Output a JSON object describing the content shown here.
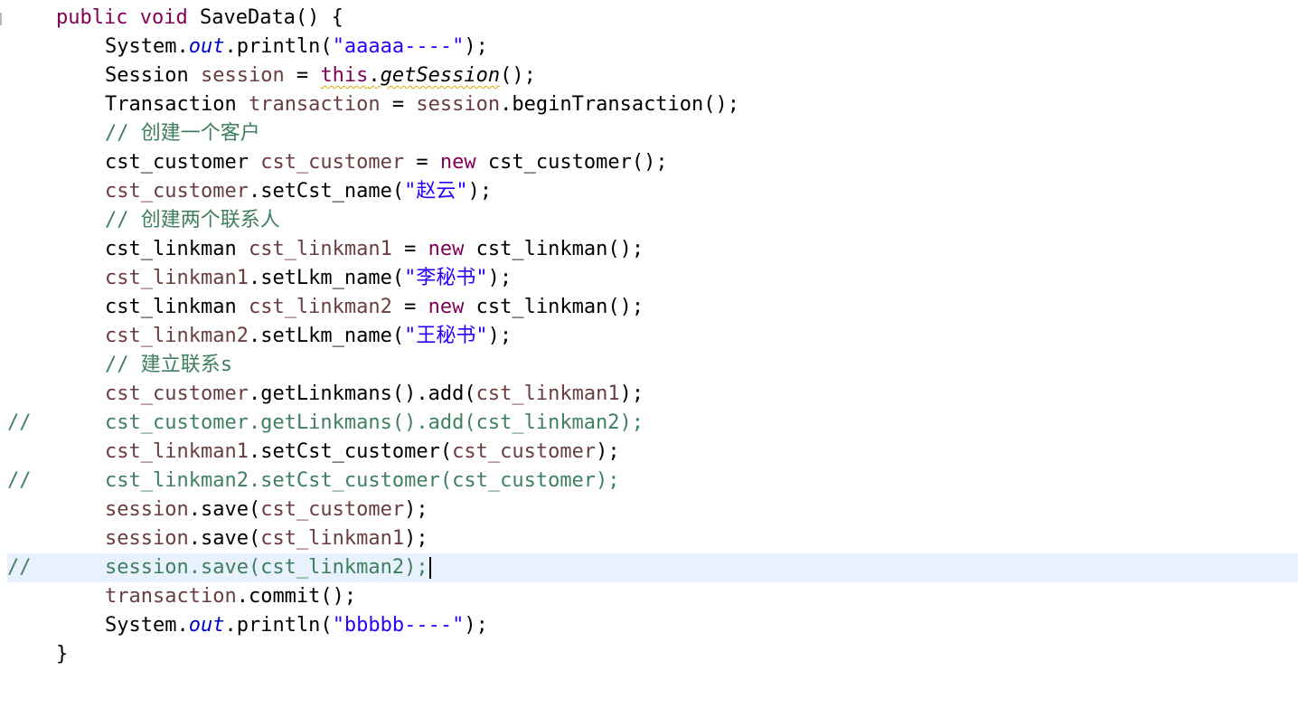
{
  "editor": {
    "line_comment_marker": "//",
    "line1": {
      "kw1": "public",
      "kw2": "void",
      "name": "SaveData() {"
    },
    "line2": {
      "a": "System.",
      "field": "out",
      "b": ".println(",
      "str": "\"aaaaa----\"",
      "c": ");"
    },
    "line3": {
      "type": "Session",
      "var": "session",
      "eq": " = ",
      "kw": "this",
      "dot": ".",
      "call": "getSession",
      "end": "();"
    },
    "line4": {
      "type": "Transaction",
      "var": "transaction",
      "eq": " = ",
      "obj": "session",
      "call": ".beginTransaction();"
    },
    "line5": {
      "comment": "// 创建一个客户"
    },
    "line6": {
      "type": "cst_customer",
      "var": "cst_customer",
      "eq": " = ",
      "kw": "new",
      "call": " cst_customer();"
    },
    "line7": {
      "obj": "cst_customer",
      "call": ".setCst_name(",
      "str": "\"赵云\"",
      "end": ");"
    },
    "line8": {
      "comment": "// 创建两个联系人"
    },
    "line9": {
      "type": "cst_linkman",
      "var": "cst_linkman1",
      "eq": " = ",
      "kw": "new",
      "call": " cst_linkman();"
    },
    "line10": {
      "obj": "cst_linkman1",
      "call": ".setLkm_name(",
      "str": "\"李秘书\"",
      "end": ");"
    },
    "line11": {
      "type": "cst_linkman",
      "var": "cst_linkman2",
      "eq": " = ",
      "kw": "new",
      "call": " cst_linkman();"
    },
    "line12": {
      "obj": "cst_linkman2",
      "call": ".setLkm_name(",
      "str": "\"王秘书\"",
      "end": ");"
    },
    "line13": {
      "comment": "// 建立联系s"
    },
    "line14": {
      "obj": "cst_customer",
      "call": ".getLinkmans().add(",
      "arg": "cst_linkman1",
      "end": ");"
    },
    "line15": {
      "code": "cst_customer.getLinkmans().add(cst_linkman2);"
    },
    "line16": {
      "obj": "cst_linkman1",
      "call": ".setCst_customer(",
      "arg": "cst_customer",
      "end": ");"
    },
    "line17": {
      "code": "cst_linkman2.setCst_customer(cst_customer);"
    },
    "line18": {
      "obj": "session",
      "call": ".save(",
      "arg": "cst_customer",
      "end": ");"
    },
    "line19": {
      "obj": "session",
      "call": ".save(",
      "arg": "cst_linkman1",
      "end": ");"
    },
    "line20": {
      "code": "session.save(cst_linkman2);"
    },
    "line21": {
      "obj": "transaction",
      "call": ".commit();"
    },
    "line22": {
      "a": "System.",
      "field": "out",
      "b": ".println(",
      "str": "\"bbbbb----\"",
      "c": ");"
    },
    "line23": {
      "brace": "}"
    }
  },
  "colors": {
    "keyword": "#7f0055",
    "string": "#2a00ff",
    "field": "#0000c0",
    "local_variable": "#6a3e3e",
    "comment": "#3f7f5f",
    "current_line_highlight": "#e8f2fe",
    "warning_underline": "#d8a800"
  }
}
